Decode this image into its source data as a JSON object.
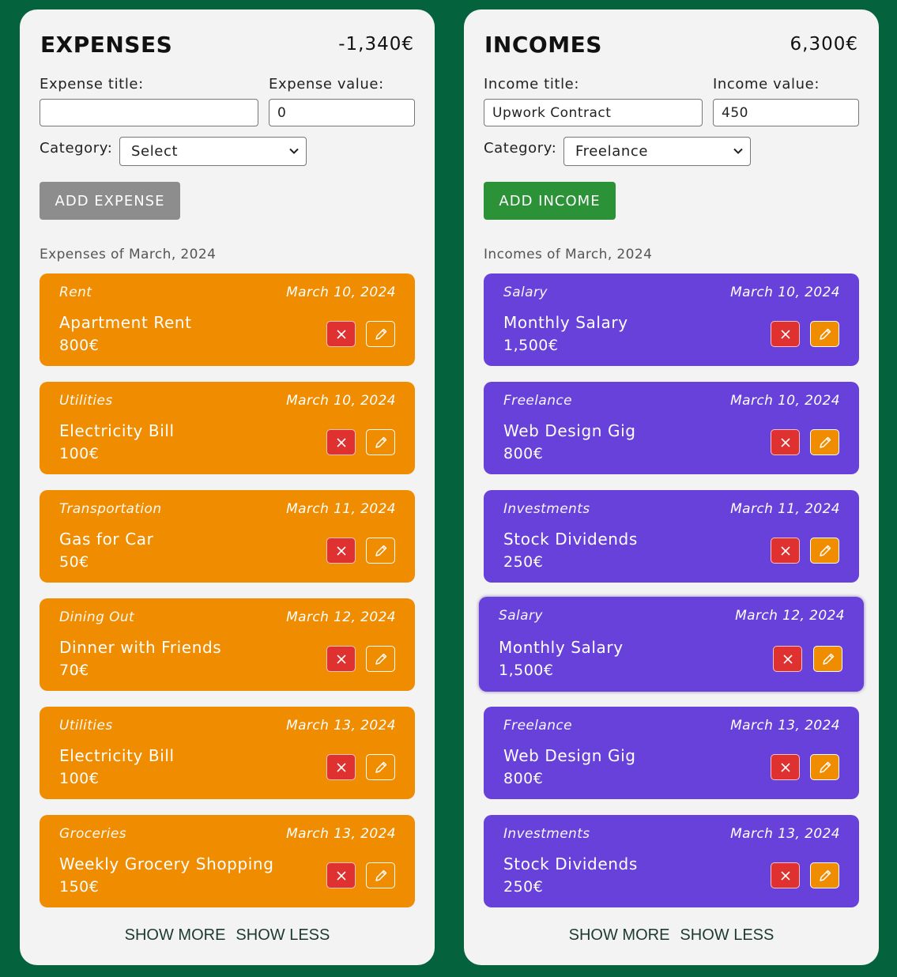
{
  "colors": {
    "background": "#04633d",
    "panel": "#f3f3f3",
    "expense_card": "#f08c00",
    "income_card": "#6741d9",
    "delete_button": "#e03131",
    "add_expense_button": "#8d8d8d",
    "add_income_button": "#2b9237"
  },
  "expenses": {
    "title": "EXPENSES",
    "total": "-1,340€",
    "title_label": "Expense title:",
    "title_value": "",
    "value_label": "Expense value:",
    "value_value": "0",
    "category_label": "Category:",
    "category_selected": "Select",
    "add_button": "ADD EXPENSE",
    "month_heading": "Expenses of March, 2024",
    "items": [
      {
        "category": "Rent",
        "date": "March 10, 2024",
        "title": "Apartment Rent",
        "amount": "800€"
      },
      {
        "category": "Utilities",
        "date": "March 10, 2024",
        "title": "Electricity Bill",
        "amount": "100€"
      },
      {
        "category": "Transportation",
        "date": "March 11, 2024",
        "title": "Gas for Car",
        "amount": "50€"
      },
      {
        "category": "Dining Out",
        "date": "March 12, 2024",
        "title": "Dinner with Friends",
        "amount": "70€"
      },
      {
        "category": "Utilities",
        "date": "March 13, 2024",
        "title": "Electricity Bill",
        "amount": "100€"
      },
      {
        "category": "Groceries",
        "date": "March 13, 2024",
        "title": "Weekly Grocery Shopping",
        "amount": "150€"
      }
    ],
    "show_more": "SHOW MORE",
    "show_less": "SHOW LESS"
  },
  "incomes": {
    "title": "INCOMES",
    "total": "6,300€",
    "title_label": "Income title:",
    "title_value": "Upwork Contract",
    "value_label": "Income value:",
    "value_value": "450",
    "category_label": "Category:",
    "category_selected": "Freelance",
    "add_button": "ADD INCOME",
    "month_heading": "Incomes of March, 2024",
    "items": [
      {
        "category": "Salary",
        "date": "March 10, 2024",
        "title": "Monthly Salary",
        "amount": "1,500€"
      },
      {
        "category": "Freelance",
        "date": "March 10, 2024",
        "title": "Web Design Gig",
        "amount": "800€"
      },
      {
        "category": "Investments",
        "date": "March 11, 2024",
        "title": "Stock Dividends",
        "amount": "250€"
      },
      {
        "category": "Salary",
        "date": "March 12, 2024",
        "title": "Monthly Salary",
        "amount": "1,500€"
      },
      {
        "category": "Freelance",
        "date": "March 13, 2024",
        "title": "Web Design Gig",
        "amount": "800€"
      },
      {
        "category": "Investments",
        "date": "March 13, 2024",
        "title": "Stock Dividends",
        "amount": "250€"
      }
    ],
    "show_more": "SHOW MORE",
    "show_less": "SHOW LESS"
  }
}
